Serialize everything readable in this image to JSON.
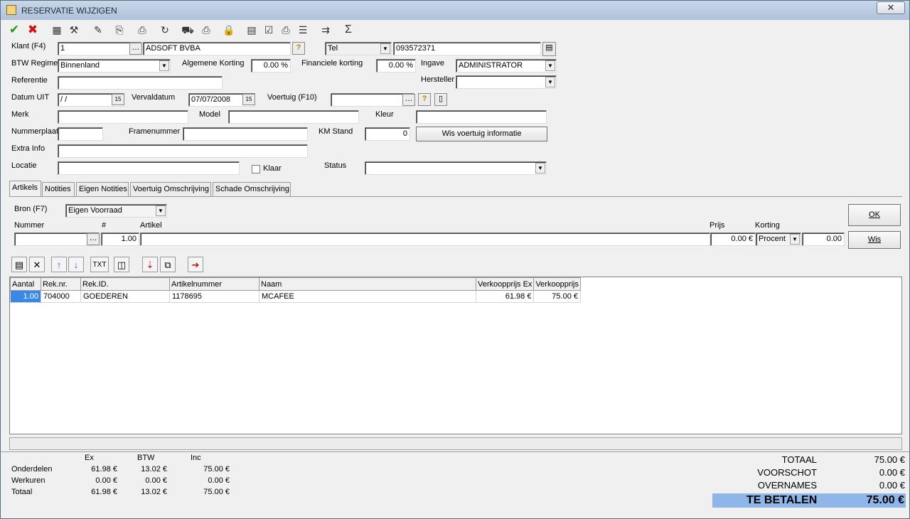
{
  "window": {
    "title": "RESERVATIE WIJZIGEN",
    "close_label": "✕"
  },
  "toolbar": [
    {
      "name": "confirm-icon",
      "glyph": "✔"
    },
    {
      "name": "cancel-icon",
      "glyph": "✖"
    },
    {
      "name": "folder-icon",
      "glyph": "▦"
    },
    {
      "name": "tools-icon",
      "glyph": "⚒"
    },
    {
      "name": "edit-icon",
      "glyph": "✎"
    },
    {
      "name": "copy-icon",
      "glyph": "⎘"
    },
    {
      "name": "print-icon",
      "glyph": "⎙"
    },
    {
      "name": "refresh-icon",
      "glyph": "↻"
    },
    {
      "name": "car-icon",
      "glyph": "⛟"
    },
    {
      "name": "print-preview-icon",
      "glyph": "⎙"
    },
    {
      "name": "lock-icon",
      "glyph": "🔒"
    },
    {
      "name": "document-icon",
      "glyph": "▤"
    },
    {
      "name": "checklist-icon",
      "glyph": "☑"
    },
    {
      "name": "print-list-icon",
      "glyph": "⎙"
    },
    {
      "name": "stack-icon",
      "glyph": "☰"
    },
    {
      "name": "export-icon",
      "glyph": "⇉"
    },
    {
      "name": "sum-icon",
      "glyph": "Σ"
    }
  ],
  "form": {
    "klant_label": "Klant (F4)",
    "klant_nr": "1",
    "klant_name": "ADSOFT BVBA",
    "tel_type": "Tel",
    "tel_value": "093572371",
    "btw_label": "BTW Regime",
    "btw_value": "Binnenland",
    "alg_korting_label": "Algemene Korting",
    "alg_korting_value": "0.00 %",
    "fin_korting_label": "Financiele korting",
    "fin_korting_value": "0.00 %",
    "ingave_label": "Ingave",
    "ingave_value": "ADMINISTRATOR",
    "referentie_label": "Referentie",
    "referentie_value": "",
    "hersteller_label": "Hersteller",
    "hersteller_value": "",
    "datum_uit_label": "Datum UIT",
    "datum_uit_value": " /  /",
    "vervaldatum_label": "Vervaldatum",
    "vervaldatum_value": "07/07/2008",
    "voertuig_label": "Voertuig (F10)",
    "voertuig_value": "",
    "merk_label": "Merk",
    "model_label": "Model",
    "kleur_label": "Kleur",
    "nummerplaat_label": "Nummerplaat",
    "framenummer_label": "Framenummer",
    "km_label": "KM Stand",
    "km_value": "0",
    "wis_voertuig_label": "Wis voertuig informatie",
    "extra_label": "Extra Info",
    "locatie_label": "Locatie",
    "klaar_label": "Klaar",
    "status_label": "Status",
    "status_value": ""
  },
  "tabs": [
    "Artikels",
    "Notities",
    "Eigen Notities",
    "Voertuig Omschrijving",
    "Schade Omschrijving"
  ],
  "article": {
    "bron_label": "Bron (F7)",
    "bron_value": "Eigen Voorraad",
    "nummer_label": "Nummer",
    "qty_label": "#",
    "artikel_label": "Artikel",
    "prijs_label": "Prijs",
    "korting_label": "Korting",
    "qty_value": "1.00",
    "prijs_value": "0.00 €",
    "korting_type": "Procent",
    "korting_value": "0.00",
    "ok_label": "OK",
    "wis_label": "Wis"
  },
  "grid": {
    "columns": [
      "Aantal",
      "Rek.nr.",
      "Rek.ID.",
      "Artikelnummer",
      "Naam",
      "Verkoopprijs Ex",
      "Verkoopprijs"
    ],
    "rows": [
      [
        "1.00",
        "704000",
        "GOEDEREN",
        "1178695",
        "MCAFEE",
        "61.98 €",
        "75.00 €"
      ]
    ]
  },
  "summary": {
    "headers": [
      "Ex",
      "BTW",
      "Inc"
    ],
    "rows": [
      {
        "label": "Onderdelen",
        "ex": "61.98 €",
        "btw": "13.02 €",
        "inc": "75.00 €"
      },
      {
        "label": "Werkuren",
        "ex": "0.00 €",
        "btw": "0.00 €",
        "inc": "0.00 €"
      },
      {
        "label": "Totaal",
        "ex": "61.98 €",
        "btw": "13.02 €",
        "inc": "75.00 €"
      }
    ]
  },
  "totals": {
    "totaal_label": "TOTAAL",
    "totaal_value": "75.00 €",
    "voorschot_label": "VOORSCHOT",
    "voorschot_value": "0.00 €",
    "overnames_label": "OVERNAMES",
    "overnames_value": "0.00 €",
    "te_betalen_label": "TE BETALEN",
    "te_betalen_value": "75.00 €"
  }
}
